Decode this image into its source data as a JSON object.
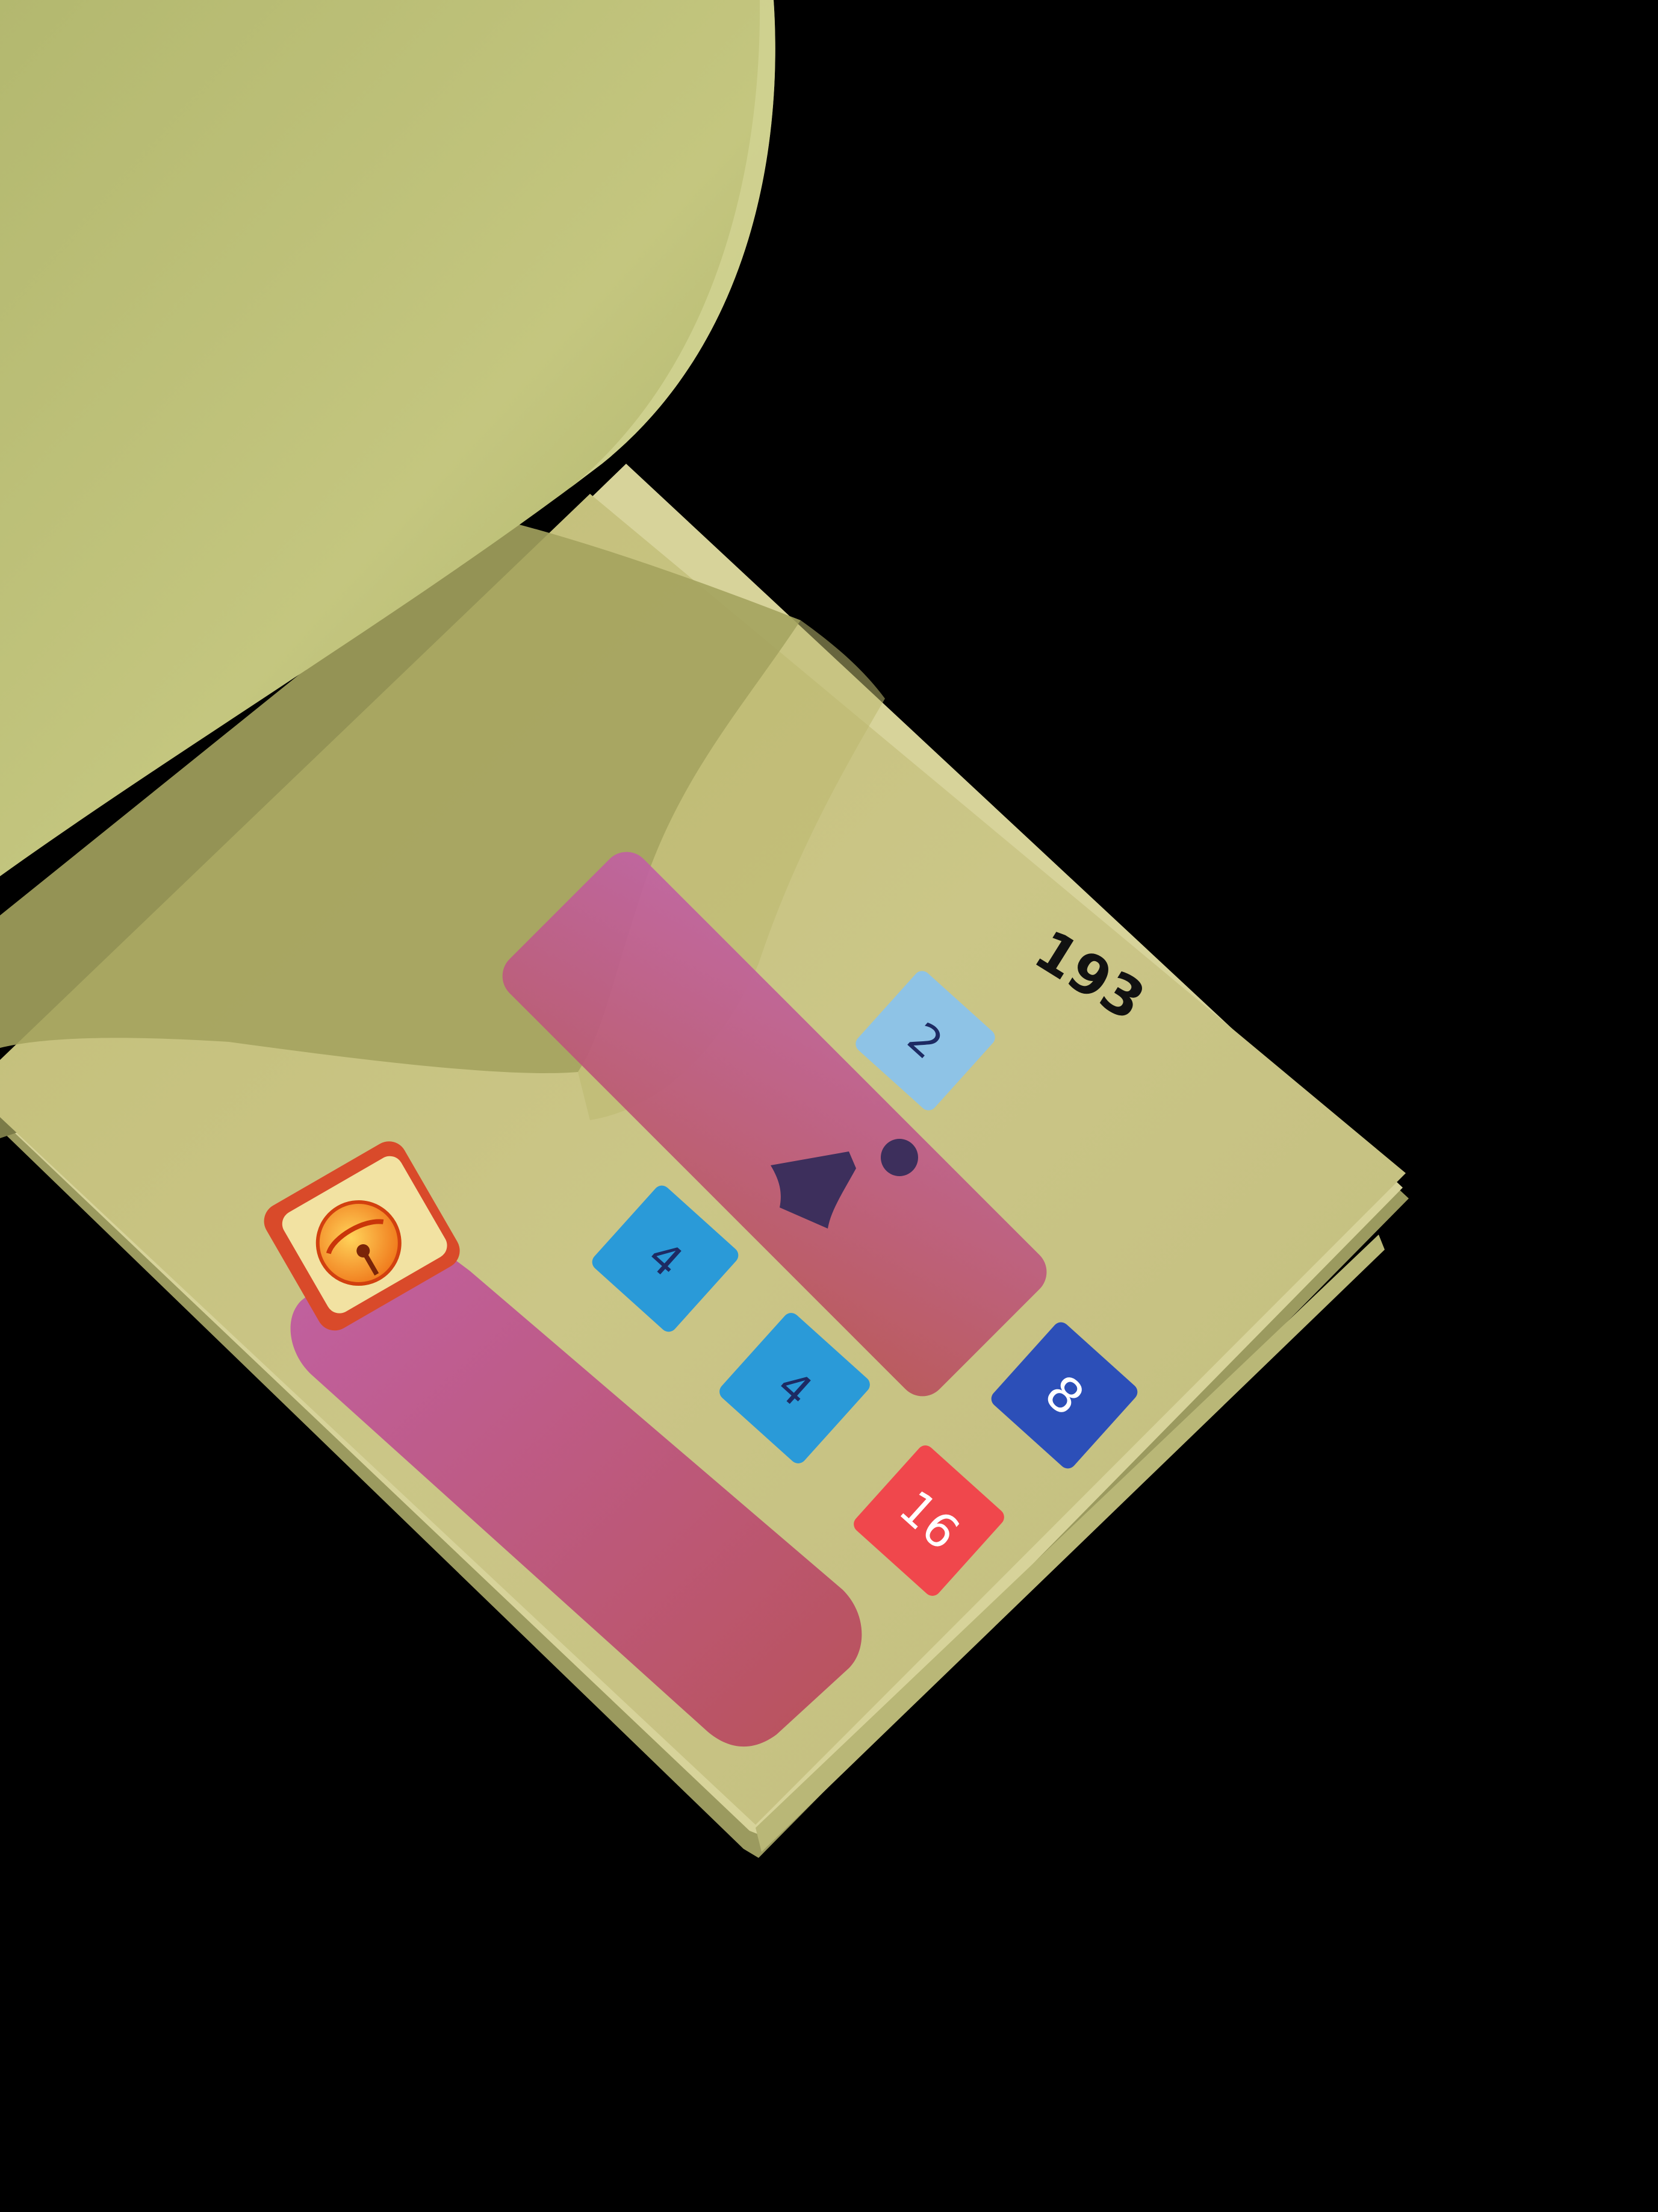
{
  "photo": {
    "page_number": "193",
    "tiles": [
      {
        "label": "2",
        "color": "#8ec3e6",
        "text_color": "#1d2a63"
      },
      {
        "label": "4",
        "color": "#2a9ad8",
        "text_color": "#1d2a63"
      },
      {
        "label": "4",
        "color": "#2a9ad8",
        "text_color": "#1d2a63"
      },
      {
        "label": "8",
        "color": "#2c4fb8",
        "text_color": "#ffffff"
      },
      {
        "label": "16",
        "color": "#f0474c",
        "text_color": "#ffffff"
      }
    ],
    "colors": {
      "background": "#000000",
      "page": "#c8c382",
      "page_lifted": "#b9ba72",
      "shadow": "#8f8f4e",
      "red_bar": "#b8556a",
      "icon_frame": "#d94a2a",
      "icon_fill": "#f2e2a2",
      "figure": "#3d2f5c"
    },
    "icon": "bell-icon"
  }
}
